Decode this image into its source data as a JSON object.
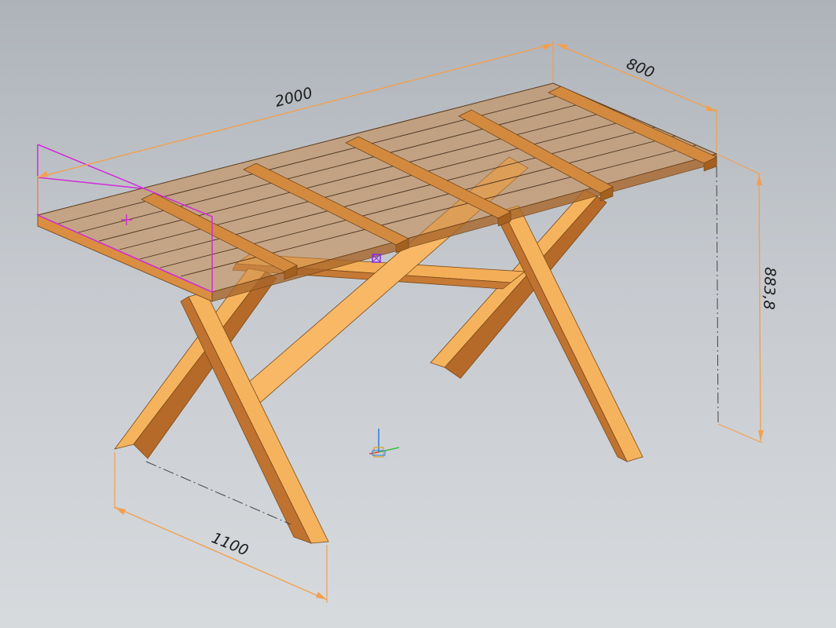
{
  "viewport": {
    "background_top": "#aeb3b9",
    "background_bottom": "#d7dadd"
  },
  "model": {
    "kind": "wooden picnic table with X-shaped legs",
    "wood_light": "#f6b35e",
    "wood_mid": "#e59b45",
    "wood_dark": "#b56a2a",
    "top_transparent": "#c6894a"
  },
  "dimensions": {
    "length": "2000",
    "width": "800",
    "height": "883,8",
    "leg_span": "1100",
    "color": "#f2a050"
  },
  "selection": {
    "color": "#d22bd8"
  },
  "triad": {
    "icon": "coordinate-system-icon"
  }
}
